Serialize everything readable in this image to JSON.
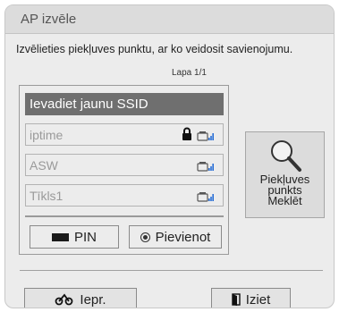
{
  "dialog": {
    "title": "AP izvēle",
    "instruction": "Izvēlieties piekļuves punktu, ar ko veidosit savienojumu.",
    "page_label": "Lapa 1/1"
  },
  "access_points": [
    {
      "label": "Ievadiet jaunu SSID",
      "selected": true,
      "locked": false,
      "signal_icon": false
    },
    {
      "label": "iptime",
      "selected": false,
      "locked": true,
      "signal_icon": true
    },
    {
      "label": "ASW",
      "selected": false,
      "locked": false,
      "signal_icon": true
    },
    {
      "label": "Tīkls1",
      "selected": false,
      "locked": false,
      "signal_icon": true
    }
  ],
  "buttons": {
    "pin_label": "PIN",
    "connect_label": "Pievienot",
    "search_label": "Piekļuves\npunkts\nMeklēt",
    "back_label": "Iepr.",
    "exit_label": "Iziet"
  },
  "icons": {
    "pin": "black-rectangle-key-icon",
    "connect": "radio-select-icon",
    "search": "magnifier-icon",
    "back": "back-remote-icon",
    "exit": "exit-door-icon",
    "lock": "lock-icon",
    "signal": "wifi-signal-icon"
  },
  "colors": {
    "selected_bg": "#6f6f6f",
    "dialog_bg": "#ececec",
    "title_bg": "#dcdcdc",
    "signal_blue": "#2a6fd6"
  }
}
